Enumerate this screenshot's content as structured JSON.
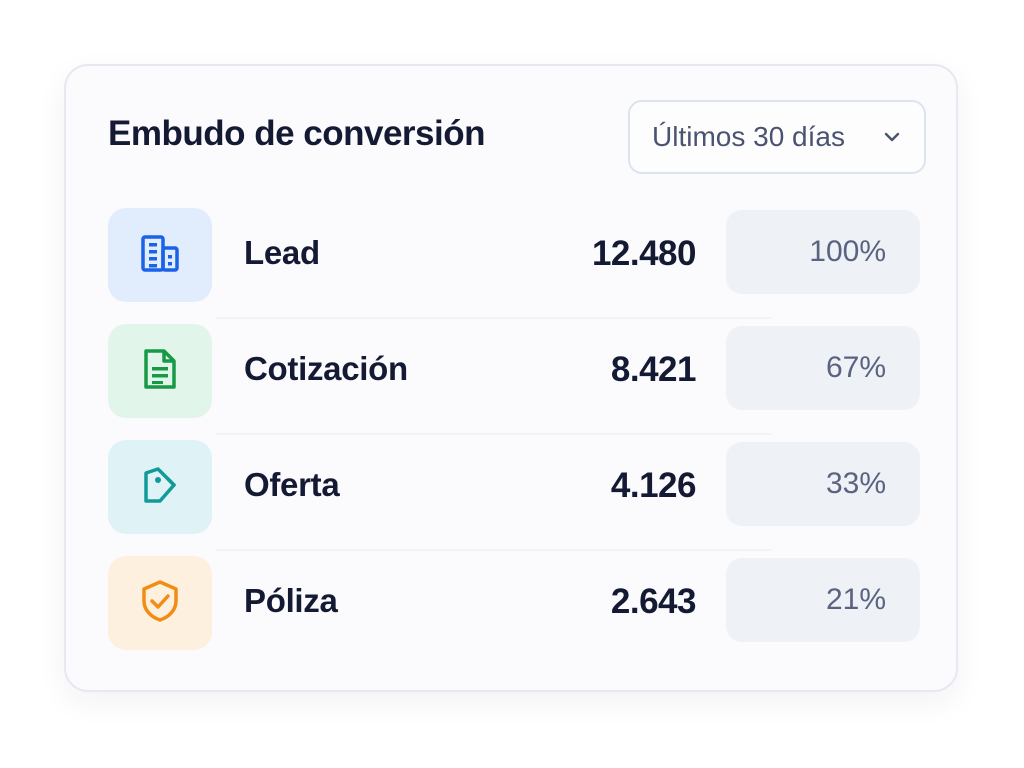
{
  "card": {
    "title": "Embudo de conversión",
    "range_select": {
      "selected": "Últimos 30 días"
    }
  },
  "stages": [
    {
      "name": "Lead",
      "count": "12.480",
      "percent": "100%",
      "icon": "building-icon",
      "color": "#1a62e8",
      "bg": "#e1ecfd"
    },
    {
      "name": "Cotización",
      "count": "8.421",
      "percent": "67%",
      "icon": "document-icon",
      "color": "#179a45",
      "bg": "#e2f5ea"
    },
    {
      "name": "Oferta",
      "count": "4.126",
      "percent": "33%",
      "icon": "tag-icon",
      "color": "#129a98",
      "bg": "#dff2f6"
    },
    {
      "name": "Póliza",
      "count": "2.643",
      "percent": "21%",
      "icon": "shield-check-icon",
      "color": "#f28c12",
      "bg": "#fdf0de"
    }
  ]
}
